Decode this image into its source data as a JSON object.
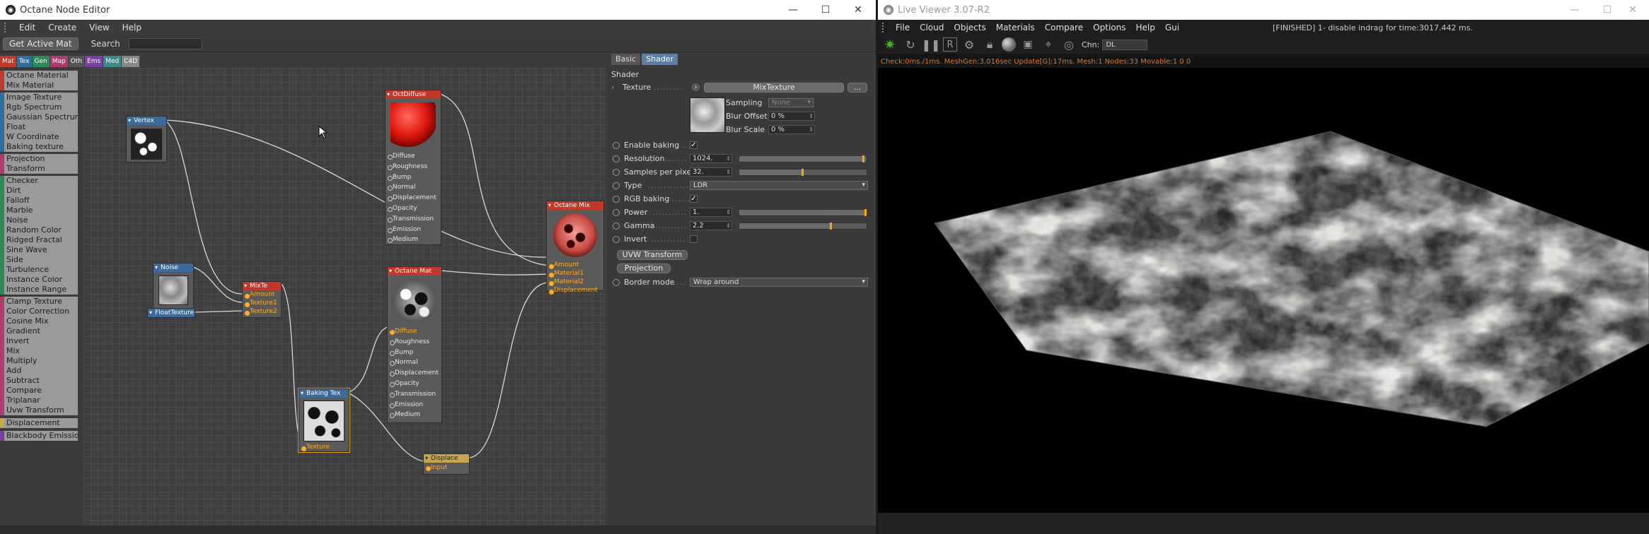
{
  "node_editor": {
    "title": "Octane Node Editor",
    "menu": [
      "Edit",
      "Create",
      "View",
      "Help"
    ],
    "get_active_mat": "Get Active Mat",
    "search_label": "Search",
    "search_value": "",
    "tabs": [
      {
        "label": "Mat",
        "color": "#c0392b"
      },
      {
        "label": "Tex",
        "color": "#2f6f9e"
      },
      {
        "label": "Gen",
        "color": "#2e8b57"
      },
      {
        "label": "Map",
        "color": "#b03a6e"
      },
      {
        "label": "Oth",
        "color": "#555555"
      },
      {
        "label": "Ems",
        "color": "#7a3fa0"
      },
      {
        "label": "Med",
        "color": "#3d8a8a"
      },
      {
        "label": "C4D",
        "color": "#888888"
      }
    ],
    "nodes_list": [
      {
        "label": "Octane Material",
        "color": "#c0392b"
      },
      {
        "label": "Mix Material",
        "color": "#c0392b"
      },
      {
        "label": "Image Texture",
        "color": "#2f6f9e"
      },
      {
        "label": "Rgb Spectrum",
        "color": "#2f6f9e"
      },
      {
        "label": "Gaussian Spectrum",
        "color": "#2f6f9e"
      },
      {
        "label": "Float",
        "color": "#2f6f9e"
      },
      {
        "label": "W Coordinate",
        "color": "#2f6f9e"
      },
      {
        "label": "Baking texture",
        "color": "#2f6f9e"
      },
      {
        "label": "Projection",
        "color": "#b03a6e"
      },
      {
        "label": "Transform",
        "color": "#b03a6e"
      },
      {
        "label": "Checker",
        "color": "#2e8b57"
      },
      {
        "label": "Dirt",
        "color": "#2e8b57"
      },
      {
        "label": "Falloff",
        "color": "#2e8b57"
      },
      {
        "label": "Marble",
        "color": "#2e8b57"
      },
      {
        "label": "Noise",
        "color": "#2e8b57"
      },
      {
        "label": "Random Color",
        "color": "#2e8b57"
      },
      {
        "label": "Ridged Fractal",
        "color": "#2e8b57"
      },
      {
        "label": "Sine Wave",
        "color": "#2e8b57"
      },
      {
        "label": "Side",
        "color": "#2e8b57"
      },
      {
        "label": "Turbulence",
        "color": "#2e8b57"
      },
      {
        "label": "Instance Color",
        "color": "#2e8b57"
      },
      {
        "label": "Instance Range",
        "color": "#2e8b57"
      },
      {
        "label": "Clamp Texture",
        "color": "#b03a6e"
      },
      {
        "label": "Color Correction",
        "color": "#b03a6e"
      },
      {
        "label": "Cosine Mix",
        "color": "#b03a6e"
      },
      {
        "label": "Gradient",
        "color": "#b03a6e"
      },
      {
        "label": "Invert",
        "color": "#b03a6e"
      },
      {
        "label": "Mix",
        "color": "#b03a6e"
      },
      {
        "label": "Multiply",
        "color": "#b03a6e"
      },
      {
        "label": "Add",
        "color": "#b03a6e"
      },
      {
        "label": "Subtract",
        "color": "#b03a6e"
      },
      {
        "label": "Compare",
        "color": "#b03a6e"
      },
      {
        "label": "Triplanar",
        "color": "#b03a6e"
      },
      {
        "label": "Uvw Transform",
        "color": "#b03a6e"
      },
      {
        "label": "Displacement",
        "color": "#c8a64a"
      },
      {
        "label": "Blackbody Emission",
        "color": "#7a3fa0"
      }
    ],
    "graph": {
      "vertex": {
        "title": "Vertex",
        "color": "#3a6b9a"
      },
      "noise": {
        "title": "Noise",
        "color": "#3a6b9a"
      },
      "float_texture": {
        "title": "FloatTexture",
        "color": "#3a6b9a"
      },
      "mixte": {
        "title": "MixTe",
        "color": "#c0392b",
        "ports": [
          "Amount",
          "Texture1",
          "Texture2"
        ]
      },
      "octdiffuse": {
        "title": "OctDiffuse",
        "color": "#c0392b",
        "ports": [
          "Diffuse",
          "Roughness",
          "Bump",
          "Normal",
          "Displacement",
          "Opacity",
          "Transmission",
          "Emission",
          "Medium"
        ]
      },
      "octane_mat": {
        "title": "Octane Mat",
        "color": "#c0392b",
        "ports": [
          "Diffuse",
          "Roughness",
          "Bump",
          "Normal",
          "Displacement",
          "Opacity",
          "Transmission",
          "Emission",
          "Medium"
        ]
      },
      "octane_mix": {
        "title": "Octane Mix",
        "color": "#c0392b",
        "ports": [
          "Amount",
          "Material1",
          "Material2",
          "Displacement"
        ]
      },
      "baking_tex": {
        "title": "Baking Tex",
        "color": "#3a6b9a",
        "ports": [
          "Texture"
        ]
      },
      "displace": {
        "title": "Displace",
        "color": "#c8a64a",
        "ports": [
          "Input"
        ]
      }
    },
    "properties": {
      "tabs": [
        "Basic",
        "Shader"
      ],
      "active_tab": "Shader",
      "section": "Shader",
      "texture_label": "Texture",
      "texture_value": "MixTexture",
      "more_btn": "...",
      "sampling_label": "Sampling",
      "sampling_value": "None",
      "blur_offset_label": "Blur Offset",
      "blur_offset_value": "0 %",
      "blur_scale_label": "Blur Scale",
      "blur_scale_value": "0 %",
      "enable_baking_label": "Enable baking",
      "enable_baking": true,
      "resolution_label": "Resolution",
      "resolution_value": "1024.",
      "resolution_frac": 0.98,
      "samples_label": "Samples per pixel",
      "samples_value": "32.",
      "samples_frac": 0.5,
      "type_label": "Type",
      "type_value": "LDR",
      "rgb_baking_label": "RGB baking",
      "rgb_baking": true,
      "power_label": "Power",
      "power_value": "1.",
      "power_frac": 1.0,
      "gamma_label": "Gamma",
      "gamma_value": "2.2",
      "gamma_frac": 0.72,
      "invert_label": "Invert",
      "invert": false,
      "uvw_btn": "UVW Transform",
      "projection_btn": "Projection",
      "border_mode_label": "Border mode",
      "border_mode_value": "Wrap around"
    }
  },
  "live_viewer": {
    "title": "Live Viewer 3.07-R2",
    "menu": [
      "File",
      "Cloud",
      "Objects",
      "Materials",
      "Compare",
      "Options",
      "Help",
      "Gui"
    ],
    "finished_msg": "[FINISHED] 1- disable indrag for time:3017.442 ms.",
    "chn_label": "Chn:",
    "chn_value": "DL",
    "status_line": "Check:0ms./1ms. MeshGen:3.016sec Update[G]:17ms. Mesh:1 Nodes:33 Movable:1  0 0",
    "toolbar_icons": [
      "render-start-icon",
      "restart-icon",
      "pause-icon",
      "region-render-icon",
      "settings-icon",
      "lock-icon",
      "material-ball-icon",
      "film-region-icon",
      "pick-focus-icon",
      "pick-material-icon"
    ]
  }
}
